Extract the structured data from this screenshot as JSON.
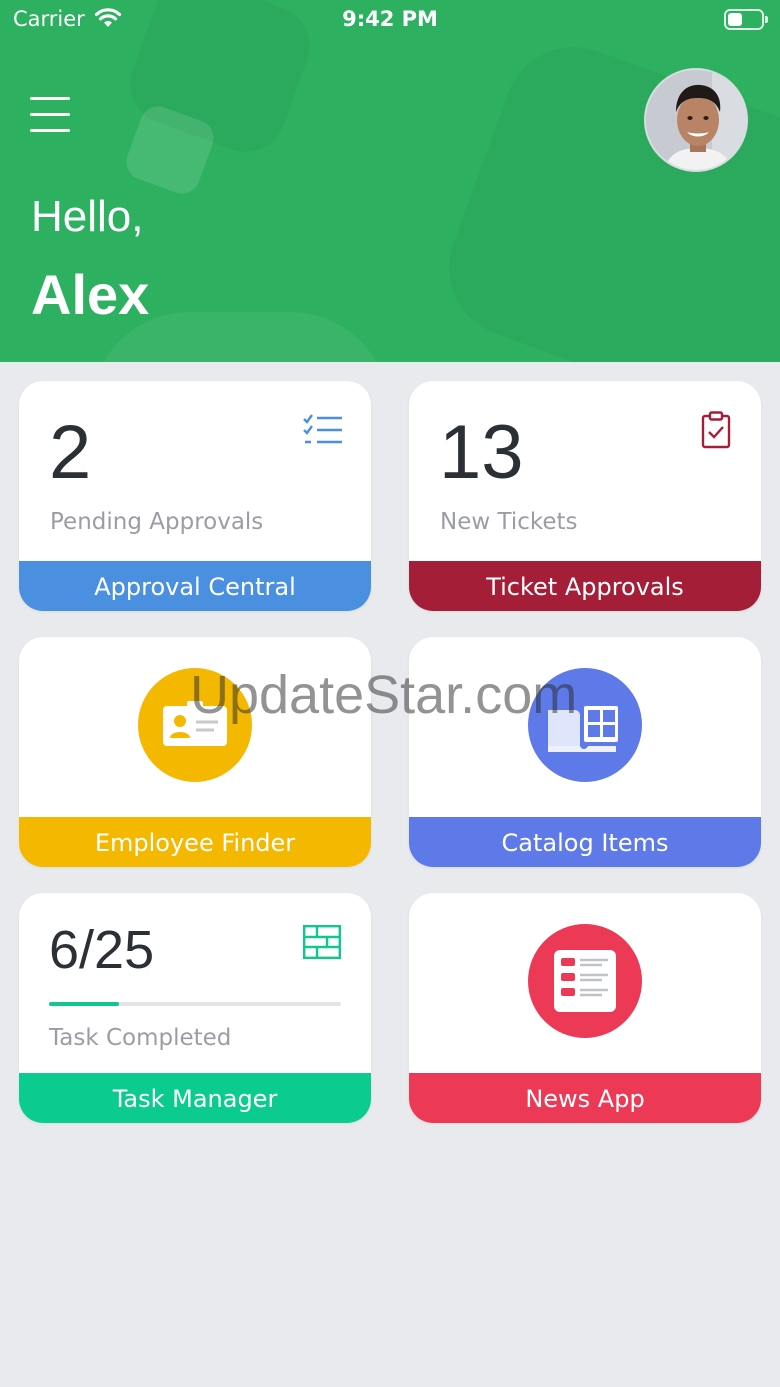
{
  "status_bar": {
    "carrier": "Carrier",
    "time": "9:42 PM"
  },
  "header": {
    "greeting": "Hello,",
    "user_name": "Alex"
  },
  "colors": {
    "header": "#2db060",
    "approval": "#4a8fe0",
    "ticket": "#a51e38",
    "employee": "#f5b800",
    "catalog": "#5e7ae8",
    "task": "#0ccb8e",
    "news": "#ec3a56"
  },
  "cards": {
    "approvals": {
      "count": "2",
      "caption": "Pending Approvals",
      "footer": "Approval Central",
      "icon": "checklist-icon"
    },
    "tickets": {
      "count": "13",
      "caption": "New Tickets",
      "footer": "Ticket Approvals",
      "icon": "clipboard-check-icon"
    },
    "employee": {
      "footer": "Employee Finder",
      "icon": "id-card-icon"
    },
    "catalog": {
      "footer": "Catalog Items",
      "icon": "catalog-book-icon"
    },
    "tasks": {
      "ratio": "6/25",
      "completed": 6,
      "total": 25,
      "caption": "Task Completed",
      "footer": "Task Manager",
      "icon": "table-grid-icon"
    },
    "news": {
      "footer": "News App",
      "icon": "news-list-icon"
    }
  },
  "watermark": "UpdateStar.com"
}
